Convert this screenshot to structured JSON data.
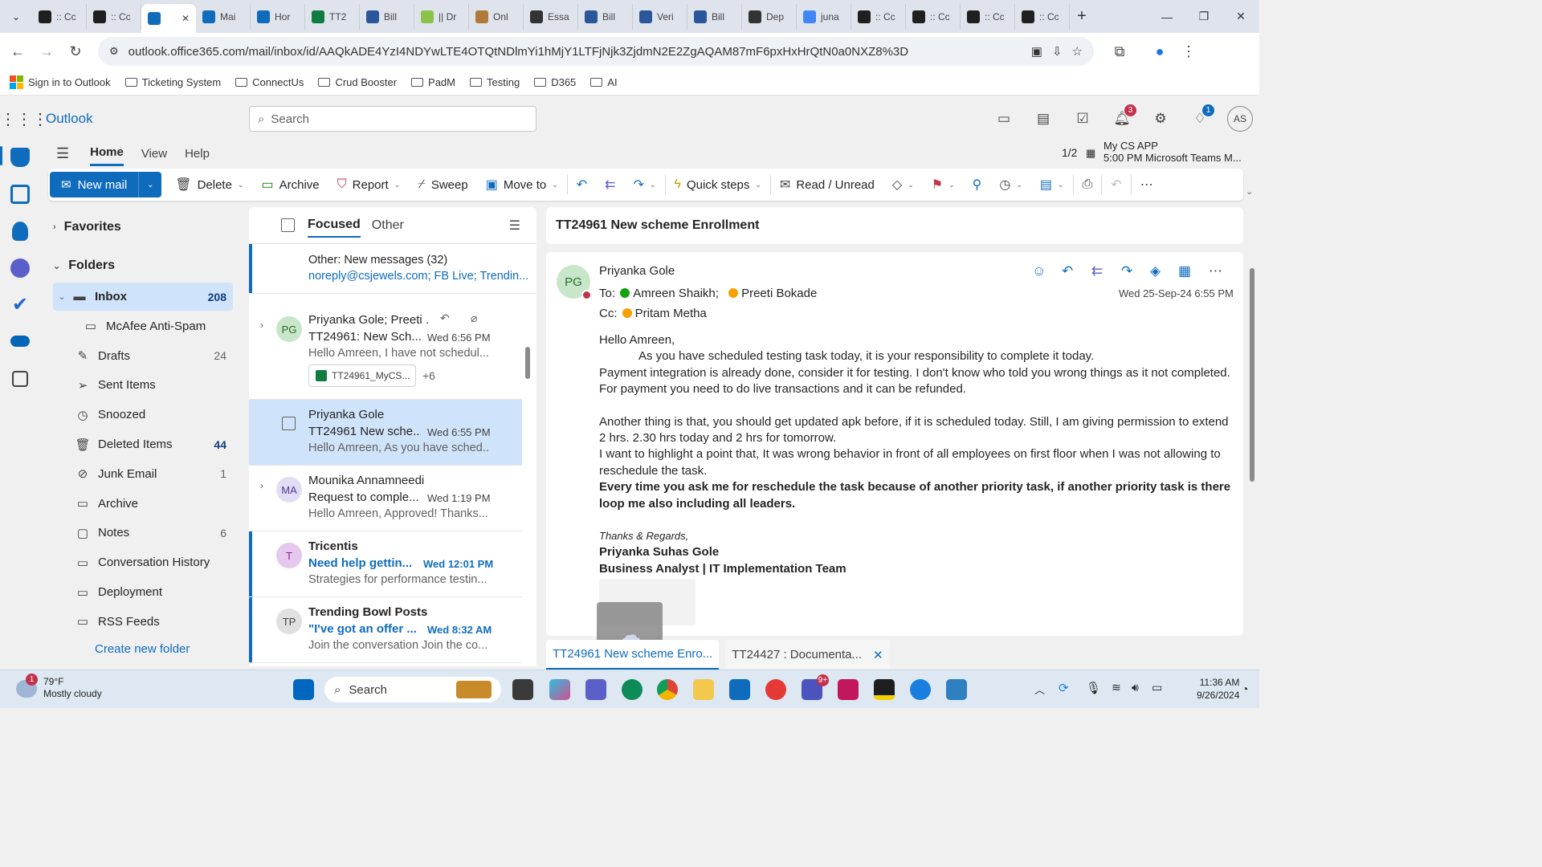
{
  "browser": {
    "tabs": [
      {
        "title": ":: Cc",
        "icon": "chatgpt-icon",
        "color": "#1f1f1f"
      },
      {
        "title": ":: Cc",
        "icon": "chatgpt-icon",
        "color": "#1f1f1f"
      },
      {
        "title": "",
        "icon": "outlook-icon",
        "color": "#0f6cbd",
        "active": true
      },
      {
        "title": "Mai",
        "icon": "outlook-icon",
        "color": "#0f6cbd"
      },
      {
        "title": "Hor",
        "icon": "onedrive-icon",
        "color": "#0f6cbd"
      },
      {
        "title": "TT2",
        "icon": "excel-icon",
        "color": "#107c41"
      },
      {
        "title": "Bill",
        "icon": "word-icon",
        "color": "#2b579a"
      },
      {
        "title": "|| Dr",
        "icon": "doc-icon",
        "color": "#8bc34a"
      },
      {
        "title": "Onl",
        "icon": "box-icon",
        "color": "#b07b3a"
      },
      {
        "title": "Essa",
        "icon": "ink-icon",
        "color": "#333333"
      },
      {
        "title": "Bill",
        "icon": "word-icon",
        "color": "#2b579a"
      },
      {
        "title": "Veri",
        "icon": "word-icon",
        "color": "#2b579a"
      },
      {
        "title": "Bill",
        "icon": "word-icon",
        "color": "#2b579a"
      },
      {
        "title": "Dep",
        "icon": "openai-icon",
        "color": "#333333"
      },
      {
        "title": "juna",
        "icon": "google-icon",
        "color": "#4285f4"
      },
      {
        "title": ":: Cc",
        "icon": "chatgpt-icon",
        "color": "#1f1f1f"
      },
      {
        "title": ":: Cc",
        "icon": "chatgpt-icon",
        "color": "#1f1f1f"
      },
      {
        "title": ":: Cc",
        "icon": "chatgpt-icon",
        "color": "#1f1f1f"
      },
      {
        "title": ":: Cc",
        "icon": "chatgpt-icon",
        "color": "#1f1f1f"
      }
    ],
    "url": "outlook.office365.com/mail/inbox/id/AAQkADE4YzI4NDYwLTE4OTQtNDlmYi1hMjY1LTFjNjk3ZjdmN2E2ZgAQAM87mF6pxHxHrQtN0a0NXZ8%3D",
    "bookmarks": [
      "Sign in to Outlook",
      "Ticketing System",
      "ConnectUs",
      "Crud Booster",
      "PadM",
      "Testing",
      "D365",
      "AI"
    ]
  },
  "header": {
    "brand": "Outlook",
    "search_placeholder": "Search",
    "notifications_count": "3",
    "tips_count": "1",
    "avatar_initials": "AS"
  },
  "ribbon": {
    "tabs": [
      "Home",
      "View",
      "Help"
    ],
    "selected_tab": "Home",
    "reminder": {
      "counter": "1/2",
      "title": "My CS APP",
      "detail": "5:00 PM Microsoft Teams M..."
    },
    "new_mail": "New mail",
    "delete": "Delete",
    "archive": "Archive",
    "report": "Report",
    "sweep": "Sweep",
    "move_to": "Move to",
    "quick_steps": "Quick steps",
    "read_unread": "Read / Unread"
  },
  "folders": {
    "favorites": "Favorites",
    "folders_label": "Folders",
    "items": [
      {
        "name": "Inbox",
        "count": "208"
      },
      {
        "name": "McAfee Anti-Spam",
        "count": ""
      },
      {
        "name": "Drafts",
        "count": "24"
      },
      {
        "name": "Sent Items",
        "count": ""
      },
      {
        "name": "Snoozed",
        "count": ""
      },
      {
        "name": "Deleted Items",
        "count": "44"
      },
      {
        "name": "Junk Email",
        "count": "1"
      },
      {
        "name": "Archive",
        "count": ""
      },
      {
        "name": "Notes",
        "count": "6"
      },
      {
        "name": "Conversation History",
        "count": ""
      },
      {
        "name": "Deployment",
        "count": ""
      },
      {
        "name": "RSS Feeds",
        "count": ""
      }
    ],
    "create_new": "Create new folder"
  },
  "message_list": {
    "tabs": [
      "Focused",
      "Other"
    ],
    "other_banner": {
      "title": "Other: New messages (32)",
      "senders": "noreply@csjewels.com; FB Live; Trendin..."
    },
    "messages": [
      {
        "from": "Priyanka Gole; Preeti ...",
        "initials": "PG",
        "subject": "TT24961: New Sch...",
        "time": "Wed 6:56 PM",
        "preview": "Hello Amreen, I have not schedul...",
        "attachment": "TT24961_MyCS...",
        "more": "+6"
      },
      {
        "from": "Priyanka Gole",
        "initials": "",
        "subject": "TT24961 New sche...",
        "time": "Wed 6:55 PM",
        "preview": "Hello Amreen, As you have sched..."
      },
      {
        "from": "Mounika Annamneedi",
        "initials": "MA",
        "subject": "Request to comple...",
        "time": "Wed 1:19 PM",
        "preview": "Hello Amreen, Approved! Thanks..."
      },
      {
        "from": "Tricentis",
        "initials": "T",
        "subject": "Need help gettin...",
        "time": "Wed 12:01 PM",
        "preview": "Strategies for performance testin..."
      },
      {
        "from": "Trending Bowl Posts",
        "initials": "TP",
        "subject": "\"I've got an offer ...",
        "time": "Wed 8:32 AM",
        "preview": "Join the conversation Join the co..."
      }
    ]
  },
  "reading": {
    "subject": "TT24961 New scheme Enrollment",
    "sender_initials": "PG",
    "sender": "Priyanka Gole",
    "to_label": "To:",
    "to": [
      "Amreen Shaikh;",
      "Preeti Bokade"
    ],
    "cc_label": "Cc:",
    "cc": "Pritam Metha",
    "date": "Wed 25-Sep-24 6:55 PM",
    "body": {
      "greeting": "Hello Amreen,",
      "p1": "As you have scheduled testing task today, it is your responsibility to complete it today.",
      "p2": "Payment integration is already done, consider it for testing.  I don't know who told you wrong things as it not completed.",
      "p3": "For payment you need to do live transactions and it can be refunded.",
      "p4": "Another thing is that, you should get updated apk before, if it is scheduled today. Still, I am giving permission to extend 2 hrs. 2.30 hrs today and 2 hrs for tomorrow.",
      "p5": "I want to highlight a point that, It was wrong behavior in front of all employees on first floor when I was not allowing to reschedule the task.",
      "p6": "Every time you ask me for reschedule the task because of another priority task, if another priority task is there loop me also including all leaders.",
      "regards": "Thanks & Regards,",
      "sig_name": "Priyanka Suhas Gole",
      "sig_title": "Business Analyst | IT Implementation Team"
    },
    "bottom_tabs": [
      "TT24961 New scheme Enro...",
      "TT24427 : Documenta..."
    ]
  },
  "taskbar": {
    "weather_temp": "79°F",
    "weather_desc": "Mostly cloudy",
    "weather_badge": "1",
    "search": "Search",
    "teams_badge": "9+",
    "time": "11:36 AM",
    "date": "9/26/2024"
  }
}
